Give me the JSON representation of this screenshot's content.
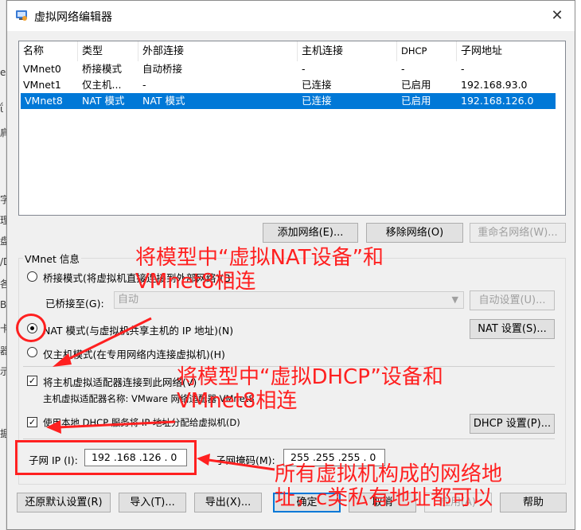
{
  "background": {
    "left_glyphs": [
      "e",
      "ΐ",
      "肩",
      "字",
      "理",
      "盘",
      "/D",
      "各",
      "B",
      "卡",
      "器",
      "示",
      "据"
    ]
  },
  "window": {
    "title": "虚拟网络编辑器",
    "close": "✕"
  },
  "network_list": {
    "headers": [
      "名称",
      "类型",
      "外部连接",
      "主机连接",
      "DHCP",
      "子网地址"
    ],
    "rows": [
      {
        "name": "VMnet0",
        "type": "桥接模式",
        "external": "自动桥接",
        "host": "-",
        "dhcp": "-",
        "subnet": "-"
      },
      {
        "name": "VMnet1",
        "type": "仅主机...",
        "external": "-",
        "host": "已连接",
        "dhcp": "已启用",
        "subnet": "192.168.93.0"
      },
      {
        "name": "VMnet8",
        "type": "NAT 模式",
        "external": "NAT 模式",
        "host": "已连接",
        "dhcp": "已启用",
        "subnet": "192.168.126.0"
      }
    ],
    "selected_row": 2
  },
  "list_buttons": {
    "add": "添加网络(E)...",
    "remove": "移除网络(O)",
    "rename": "重命名网络(W)..."
  },
  "vmnet_info": {
    "title": "VMnet 信息",
    "bridge_mode": "桥接模式(将虚拟机直接连接到外部网络)(B)",
    "bridged_to_label": "已桥接至(G):",
    "bridged_to_value": "自动",
    "auto_settings": "自动设置(U)...",
    "nat_mode": "NAT 模式(与虚拟机共享主机的 IP 地址)(N)",
    "nat_settings": "NAT 设置(S)...",
    "host_only": "仅主机模式(在专用网络内连接虚拟机)(H)",
    "connect_adapter": "将主机虚拟适配器连接到此网络(V)",
    "adapter_name": "主机虚拟适配器名称: VMware 网络适配器 VMnet8",
    "use_dhcp": "使用本地 DHCP 服务将 IP 地址分配给虚拟机(D)",
    "dhcp_settings": "DHCP 设置(P)...",
    "subnet_ip_label": "子网 IP (I):",
    "subnet_ip_value": "192 .168 .126 .  0",
    "subnet_mask_label": "子网掩码(M):",
    "subnet_mask_value": "255 .255 .255 .  0"
  },
  "footer_buttons": {
    "restore": "还原默认设置(R)",
    "import": "导入(T)...",
    "export": "导出(X)...",
    "ok": "确定",
    "cancel": "取消",
    "apply": "应用(A)",
    "help": "帮助"
  },
  "annotations": {
    "a1_line1": "将模型中“虚拟NAT设备”和",
    "a1_line2": "VMnet8相连",
    "a2_line1": "将模型中“虚拟DHCP”设备和",
    "a2_line2": "VMnet8相连",
    "a3_line1": "所有虚拟机构成的网络地",
    "a3_line2": "址，c类私有地址都可以"
  },
  "colors": {
    "annotation": "#ff2020",
    "selection": "#0078d7"
  }
}
